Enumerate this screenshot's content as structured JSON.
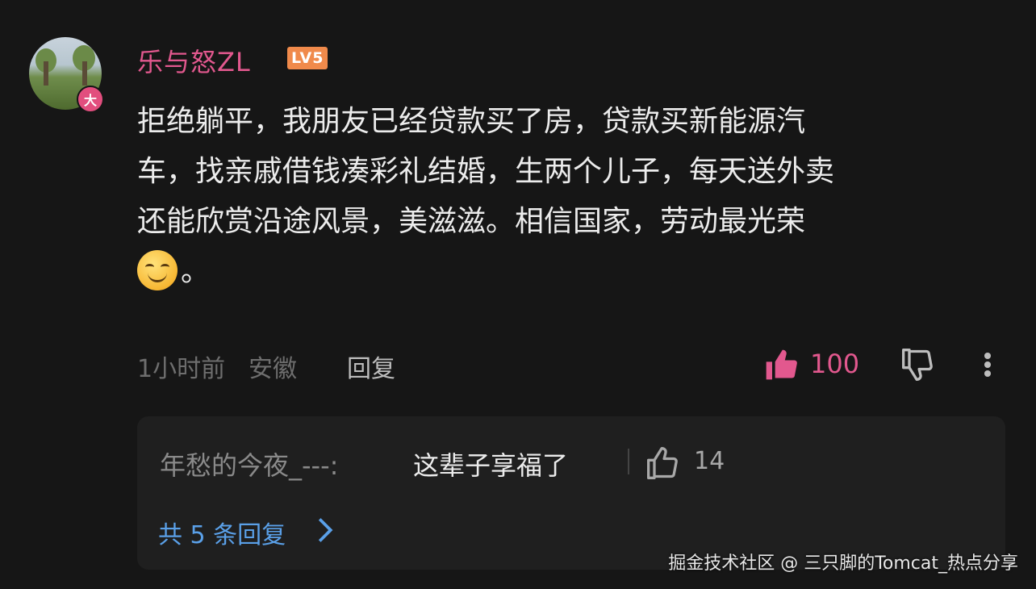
{
  "comment": {
    "author": "乐与怒ZL",
    "level": "LV5",
    "avatar_badge": "大",
    "lines": [
      "拒绝躺平，我朋友已经贷款买了房，贷款买新能源汽",
      "车，找亲戚借钱凑彩礼结婚，生两个儿子，每天送外卖",
      "还能欣赏沿途风景，美滋滋。相信国家，劳动最光荣",
      "。"
    ],
    "emoji": "smiling-face",
    "time": "1小时前",
    "location": "安徽",
    "reply_label": "回复",
    "like_count": "100",
    "accent_color": "#e2588e"
  },
  "sub_reply": {
    "author": "年愁的今夜_---:",
    "text": "这辈子享福了",
    "like_count": "14",
    "total_label": "共 5 条回复",
    "link_color": "#5aa0e8"
  },
  "watermark": "掘金技术社区 @ 三只脚的Tomcat_热点分享"
}
